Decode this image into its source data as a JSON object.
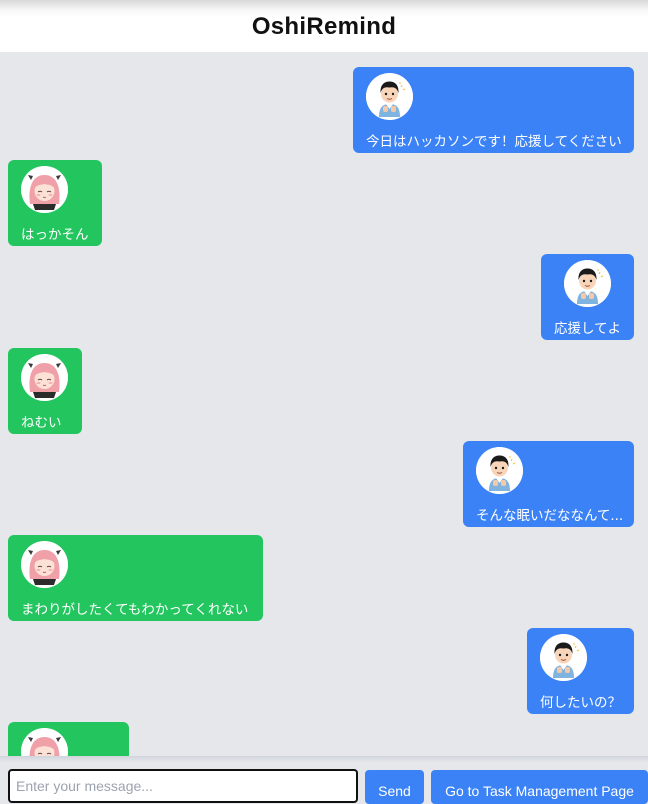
{
  "app": {
    "title": "OshiRemind"
  },
  "messages": [
    {
      "sender": "user",
      "text": "今日はハッカソンです！応援してください"
    },
    {
      "sender": "oshi",
      "text": "はっかそん"
    },
    {
      "sender": "user",
      "text": "応援してよ"
    },
    {
      "sender": "oshi",
      "text": "ねむい"
    },
    {
      "sender": "user",
      "text": "そんな眠いだななんて..."
    },
    {
      "sender": "oshi",
      "text": "まわりがしたくてもわかってくれない"
    },
    {
      "sender": "user",
      "text": "何したいの？"
    },
    {
      "sender": "oshi",
      "text": ""
    }
  ],
  "composer": {
    "placeholder": "Enter your message...",
    "value": "",
    "send_label": "Send",
    "task_label": "Go to Task Management Page"
  },
  "colors": {
    "user_bubble": "#3b82f6",
    "oshi_bubble": "#22c55e",
    "chat_background": "#e5e7eb"
  },
  "icons": {
    "user_avatar": "boy-avatar-icon",
    "oshi_avatar": "pink-hair-girl-avatar-icon"
  }
}
